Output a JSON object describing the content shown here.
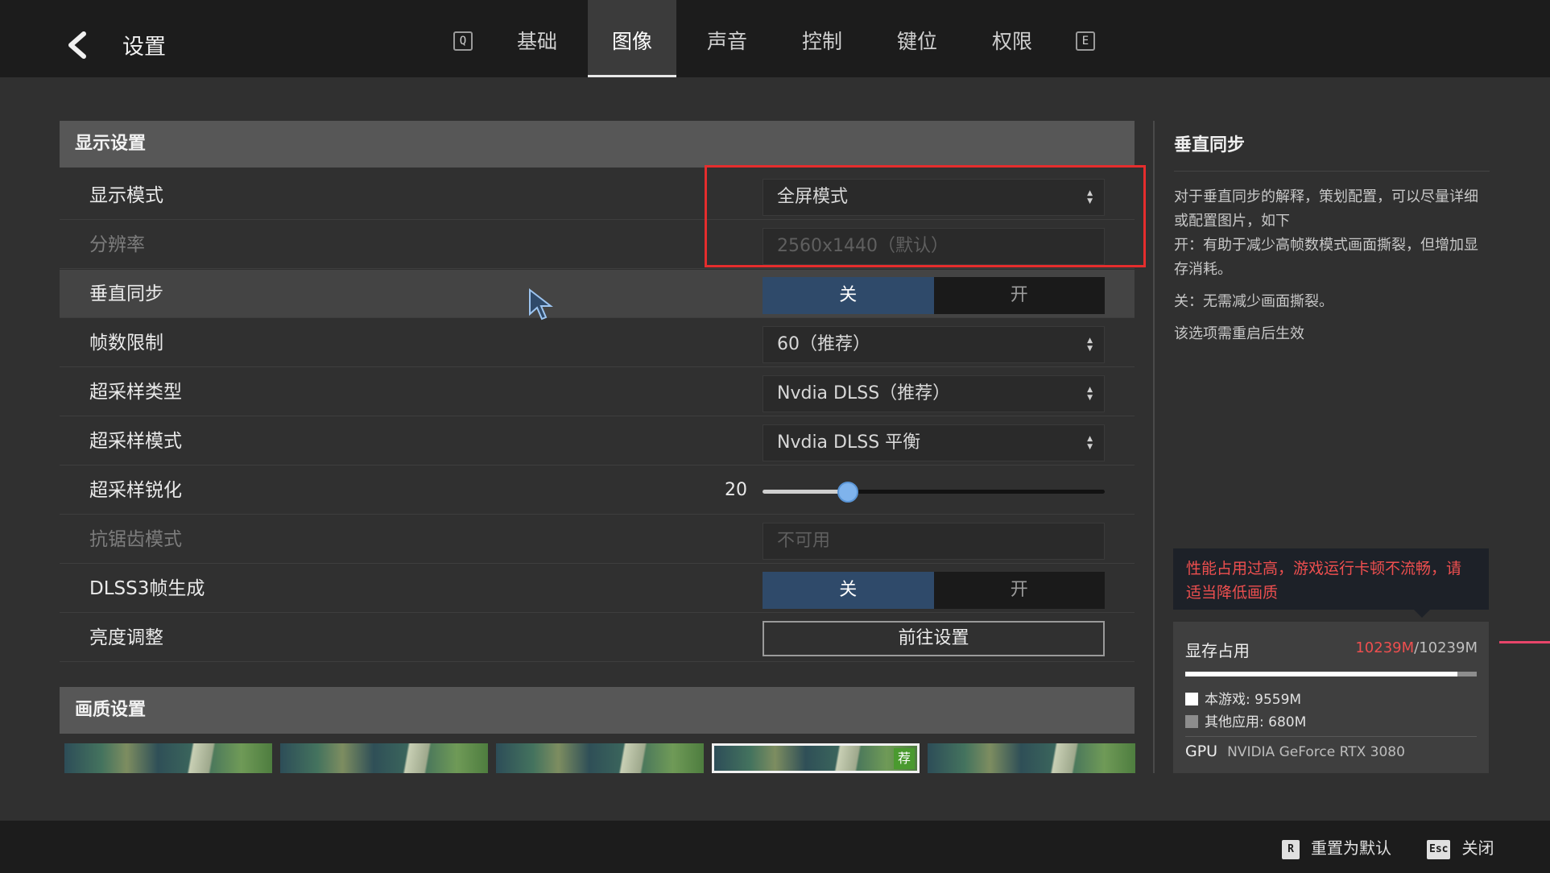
{
  "header": {
    "title": "设置",
    "prev_tab_key": "Q",
    "next_tab_key": "E",
    "tabs": [
      {
        "label": "基础"
      },
      {
        "label": "图像"
      },
      {
        "label": "声音"
      },
      {
        "label": "控制"
      },
      {
        "label": "键位"
      },
      {
        "label": "权限"
      }
    ],
    "active_tab": "图像"
  },
  "display_section": {
    "title": "显示设置",
    "display_mode": {
      "label": "显示模式",
      "value": "全屏模式"
    },
    "resolution": {
      "label": "分辨率",
      "value": "2560x1440（默认）"
    },
    "vsync": {
      "label": "垂直同步",
      "off": "关",
      "on": "开",
      "selected": "关"
    },
    "frame_limit": {
      "label": "帧数限制",
      "value": "60（推荐）"
    },
    "upscale_type": {
      "label": "超采样类型",
      "value": "Nvdia DLSS（推荐）"
    },
    "upscale_mode": {
      "label": "超采样模式",
      "value": "Nvdia DLSS 平衡"
    },
    "upscale_sharpen": {
      "label": "超采样锐化",
      "value": "20",
      "fraction": 0.25
    },
    "antialias": {
      "label": "抗锯齿模式",
      "value": "不可用"
    },
    "dlss3": {
      "label": "DLSS3帧生成",
      "off": "关",
      "on": "开",
      "selected": "关"
    },
    "brightness": {
      "label": "亮度调整",
      "button": "前往设置"
    }
  },
  "quality_section": {
    "title": "画质设置",
    "presets_count": 5,
    "selected_index": 3,
    "recommended_badge": "荐"
  },
  "info_panel": {
    "title": "垂直同步",
    "desc": "对于垂直同步的解释，策划配置，可以尽量详细或配置图片，如下",
    "on_text": "开：有助于减少高帧数模式画面撕裂，但增加显存消耗。",
    "off_text": "关：无需减少画面撕裂。",
    "note": "该选项需重启后生效"
  },
  "warning": {
    "text": "性能占用过高，游戏运行卡顿不流畅，请适当降低画质"
  },
  "vram": {
    "title": "显存占用",
    "used": "10239M",
    "total": "/10239M",
    "game_fraction": 0.9335,
    "game_label": "本游戏: 9559M",
    "other_label": "其他应用: 680M",
    "gpu_label": "GPU",
    "gpu_name": "NVIDIA GeForce RTX 3080"
  },
  "footer": {
    "reset_key": "R",
    "reset_label": "重置为默认",
    "close_key": "Esc",
    "close_label": "关闭"
  },
  "colors": {
    "accent_blue": "#2f4a6a",
    "warning_red": "#ee4f4f",
    "highlight_box": "#e52d2d",
    "slider_knob": "#7fb3ec"
  }
}
